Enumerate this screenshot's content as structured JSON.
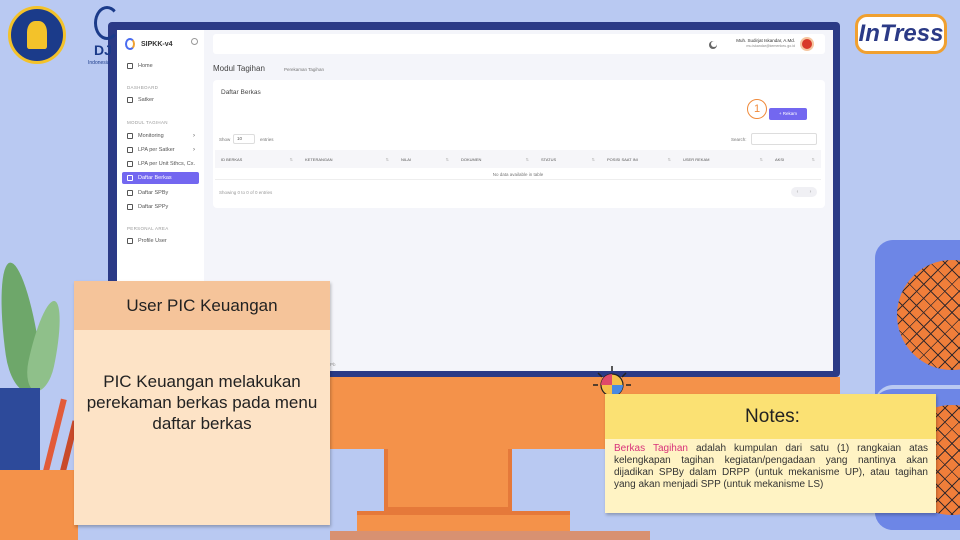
{
  "background": {
    "accent_orange": "#f4924a",
    "monitor_frame": "#2b3a86",
    "page_bg": "#b9c9f2"
  },
  "logos": {
    "intress_text": "InTress",
    "djpb_text": "DJ",
    "djpb_sub": "Indonesia"
  },
  "app": {
    "brand": "SIPKK-v4",
    "sidebar": {
      "home": "Home",
      "section_dashboard": "DASHBOARD",
      "satker": "Satker",
      "section_modul": "MODUL TAGIHAN",
      "monitoring": "Monitoring",
      "lpa_satker": "LPA per Satker",
      "lpa_unit": "LPA per Unit Sthcs, Cx.",
      "daftar_berkas": "Daftar Berkas",
      "daftar_spby": "Daftar SPBy",
      "daftar_spp": "Daftar SPPy",
      "section_personal": "PERSONAL AREA",
      "profile": "Profile User"
    },
    "topbar": {
      "user_name": "Muh. Sudirjat Iskandar, A.Md.",
      "user_email": "mu.iskandar@kemenkeu.go.id"
    },
    "page_title": "Modul Tagihan",
    "breadcrumb": "Perekaman Tagihan",
    "card": {
      "title": "Daftar Berkas",
      "step_number": "1",
      "rekam_button": "+ Rekam",
      "show_label": "Show",
      "show_value": "10",
      "entries_label": "entries",
      "search_label": "Search:",
      "columns": [
        "ID BERKAS",
        "KETERANGAN",
        "NILAI",
        "DOKUMEN",
        "STATUS",
        "POSISI SAAT INI",
        "USER REKAM",
        "AKSI"
      ],
      "empty_message": "No data available in table",
      "showing": "Showing 0 to 0 of 0 entries",
      "pager_prev": "‹",
      "pager_next": "›"
    },
    "footer": "Pb"
  },
  "info_box": {
    "title": "User PIC Keuangan",
    "body": "PIC Keuangan melakukan perekaman berkas pada menu daftar berkas"
  },
  "notes": {
    "title": "Notes:",
    "term": "Berkas Tagihan",
    "body": " adalah kumpulan dari satu (1) rangkaian atas kelengkapan tagihan kegiatan/pengadaan yang nantinya akan dijadikan SPBy dalam DRPP (untuk mekanisme UP), atau tagihan yang akan menjadi SPP (untuk mekanisme LS)"
  }
}
